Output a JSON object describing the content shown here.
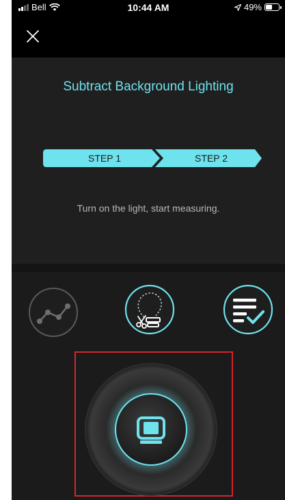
{
  "status_bar": {
    "carrier": "Bell",
    "time": "10:44 AM",
    "battery": "49%",
    "battery_level": 0.49
  },
  "nav": {
    "close_icon": "close-icon"
  },
  "page": {
    "title": "Subtract Background Lighting",
    "steps": [
      "STEP 1",
      "STEP 2"
    ],
    "instruction": "Turn on the light, start measuring."
  },
  "modes": [
    {
      "icon": "line-chart-icon",
      "active": false
    },
    {
      "icon": "bulb-cut-icon",
      "active": true
    },
    {
      "icon": "checklist-icon",
      "active": false
    }
  ],
  "measure": {
    "icon": "meter-icon"
  },
  "colors": {
    "accent": "#6ee3ee",
    "background": "#1b1b1b",
    "highlight_border": "#d8232a"
  }
}
